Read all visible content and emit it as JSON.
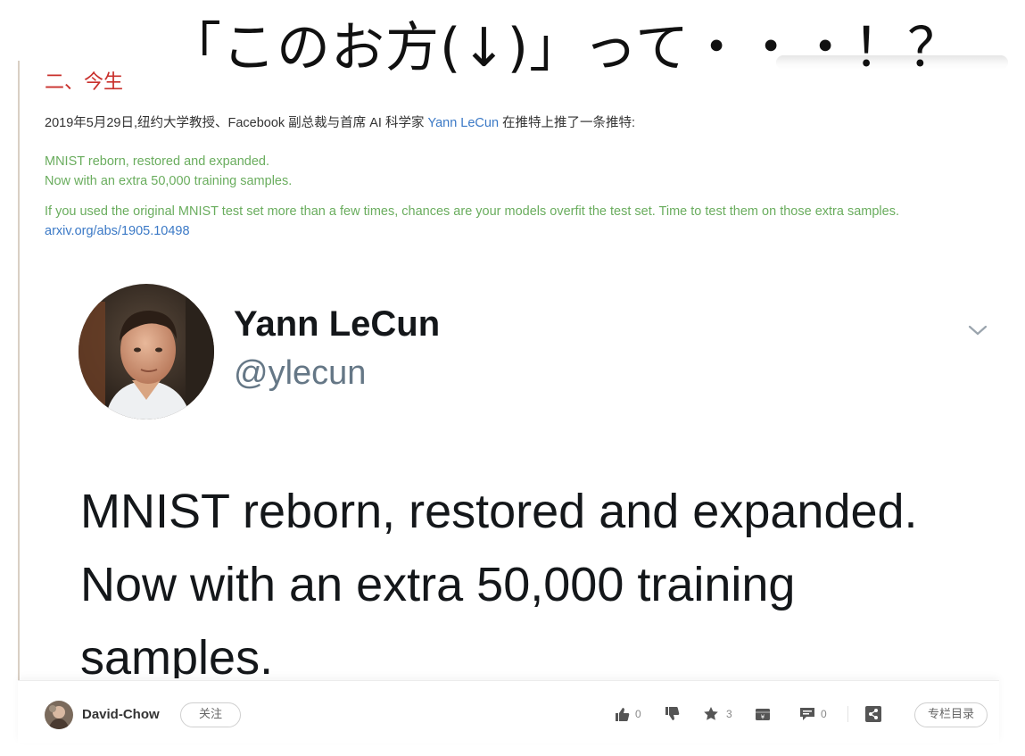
{
  "overlay": {
    "caption": "「このお方(↓)」って・・・！？"
  },
  "article": {
    "section_heading": "二、今生",
    "intro_before": "2019年5月29日,纽约大学教授、Facebook 副总裁与首席 AI 科学家 ",
    "intro_link": "Yann LeCun",
    "intro_after": " 在推特上推了一条推特:",
    "quote_line1": "MNIST reborn, restored and expanded.",
    "quote_line2": "Now with an extra 50,000 training samples.",
    "quote_para2": "If you used the original MNIST test set more than a few times, chances are your models overfit the test set. Time to test them on those extra samples. ",
    "quote_link": "arxiv.org/abs/1905.10498"
  },
  "tweet": {
    "name": "Yann LeCun",
    "handle": "@ylecun",
    "text_line1": "MNIST reborn, restored and expanded.",
    "text_line2": "Now with an extra 50,000 training",
    "text_line3": "samples."
  },
  "action_bar": {
    "author_name": "David-Chow",
    "follow_label": "关注",
    "like_count": "0",
    "dislike_count": "",
    "favorite_count": "3",
    "comment_count": "0",
    "toc_label": "专栏目录"
  },
  "colors": {
    "heading_red": "#c9302c",
    "quote_green": "#6aad5e",
    "link_blue": "#3b79c6",
    "tweet_text": "#14171a",
    "tweet_handle": "#657786"
  },
  "icons": {
    "like": "thumbs-up-icon",
    "dislike": "thumbs-down-icon",
    "favorite": "star-icon",
    "reward": "reward-icon",
    "comment": "comment-icon",
    "share": "share-icon",
    "caret": "chevron-down-icon"
  }
}
